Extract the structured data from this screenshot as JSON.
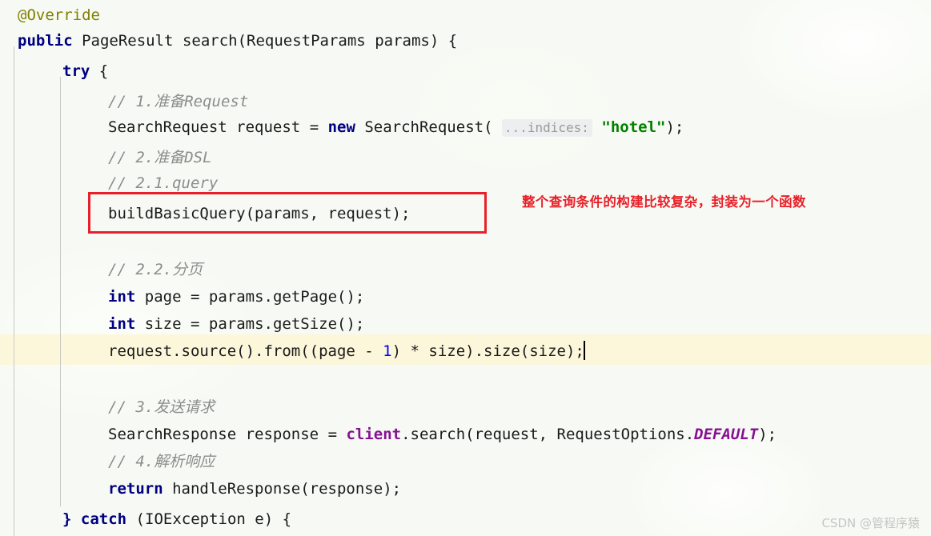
{
  "editor": {
    "background_color": "#f7faf4",
    "current_line_highlight_color": "#fcf6da",
    "indent_guide_color": "#c7c9c4",
    "font_size_px": 19,
    "line_height_px": 38
  },
  "colors": {
    "keyword": "#000080",
    "annotation": "#808000",
    "comment": "#8c8c8c",
    "string": "#008000",
    "number": "#0000ff",
    "field": "#871094",
    "static_field": "#871094",
    "plain_text": "#1a1a1a",
    "annotation_red": "#e8202a",
    "watermark": "#c3c6c3",
    "param_hint_bg": "#eceef0",
    "param_hint_fg": "#9a9a9a"
  },
  "code": {
    "language": "Java",
    "lines": [
      {
        "n": 1,
        "indent": 0,
        "text": "@Override"
      },
      {
        "n": 2,
        "indent": 0,
        "text": "public PageResult search(RequestParams params) {"
      },
      {
        "n": 3,
        "indent": 1,
        "text": "try {"
      },
      {
        "n": 4,
        "indent": 2,
        "text": "// 1.准备Request"
      },
      {
        "n": 5,
        "indent": 2,
        "text": "SearchRequest request = new SearchRequest( ...indices: \"hotel\");"
      },
      {
        "n": 6,
        "indent": 2,
        "text": "// 2.准备DSL"
      },
      {
        "n": 7,
        "indent": 2,
        "text": "// 2.1.query"
      },
      {
        "n": 8,
        "indent": 2,
        "text": "buildBasicQuery(params, request);"
      },
      {
        "n": 9,
        "indent": 2,
        "text": ""
      },
      {
        "n": 10,
        "indent": 2,
        "text": "// 2.2.分页"
      },
      {
        "n": 11,
        "indent": 2,
        "text": "int page = params.getPage();"
      },
      {
        "n": 12,
        "indent": 2,
        "text": "int size = params.getSize();"
      },
      {
        "n": 13,
        "indent": 2,
        "text": "request.source().from((page - 1) * size).size(size);"
      },
      {
        "n": 14,
        "indent": 2,
        "text": ""
      },
      {
        "n": 15,
        "indent": 2,
        "text": "// 3.发送请求"
      },
      {
        "n": 16,
        "indent": 2,
        "text": "SearchResponse response = client.search(request, RequestOptions.DEFAULT);"
      },
      {
        "n": 17,
        "indent": 2,
        "text": "// 4.解析响应"
      },
      {
        "n": 18,
        "indent": 2,
        "text": "return handleResponse(response);"
      },
      {
        "n": 19,
        "indent": 1,
        "text": "} catch (IOException e) {"
      }
    ],
    "tokens": {
      "annotation_override": "@Override",
      "kw_public": "public",
      "type_page_result": "PageResult",
      "method_search": "search",
      "type_request_params": "RequestParams",
      "var_params": "params",
      "kw_try": "try",
      "comment_1": "// 1.准备Request",
      "type_search_request": "SearchRequest",
      "var_request": "request",
      "kw_new": "new",
      "param_hint_indices": "...indices:",
      "string_hotel": "\"hotel\"",
      "comment_2": "// 2.准备DSL",
      "comment_21": "// 2.1.query",
      "call_build_basic_query": "buildBasicQuery(params, request);",
      "comment_22": "// 2.2.分页",
      "kw_int": "int",
      "var_page": "page",
      "call_get_page": "params.getPage();",
      "var_size": "size",
      "call_get_size": "params.getSize();",
      "line_from_size": "request.source().from((page - 1) * size).size(size);",
      "num_one": "1",
      "comment_3": "// 3.发送请求",
      "type_search_response": "SearchResponse",
      "var_response": "response",
      "field_client": "client",
      "call_search_args": ".search(request, RequestOptions.",
      "static_default": "DEFAULT",
      "comment_4": "// 4.解析响应",
      "kw_return": "return",
      "call_handle_response": "handleResponse(response);",
      "kw_catch": "catch",
      "type_io_exception": "IOException",
      "var_e": "e"
    }
  },
  "annotations": {
    "red_note": "整个查询条件的构建比较复杂，封装为一个函数",
    "red_box_target_line": "buildBasicQuery(params, request);"
  },
  "watermark": {
    "text": "CSDN @管程序猿"
  }
}
